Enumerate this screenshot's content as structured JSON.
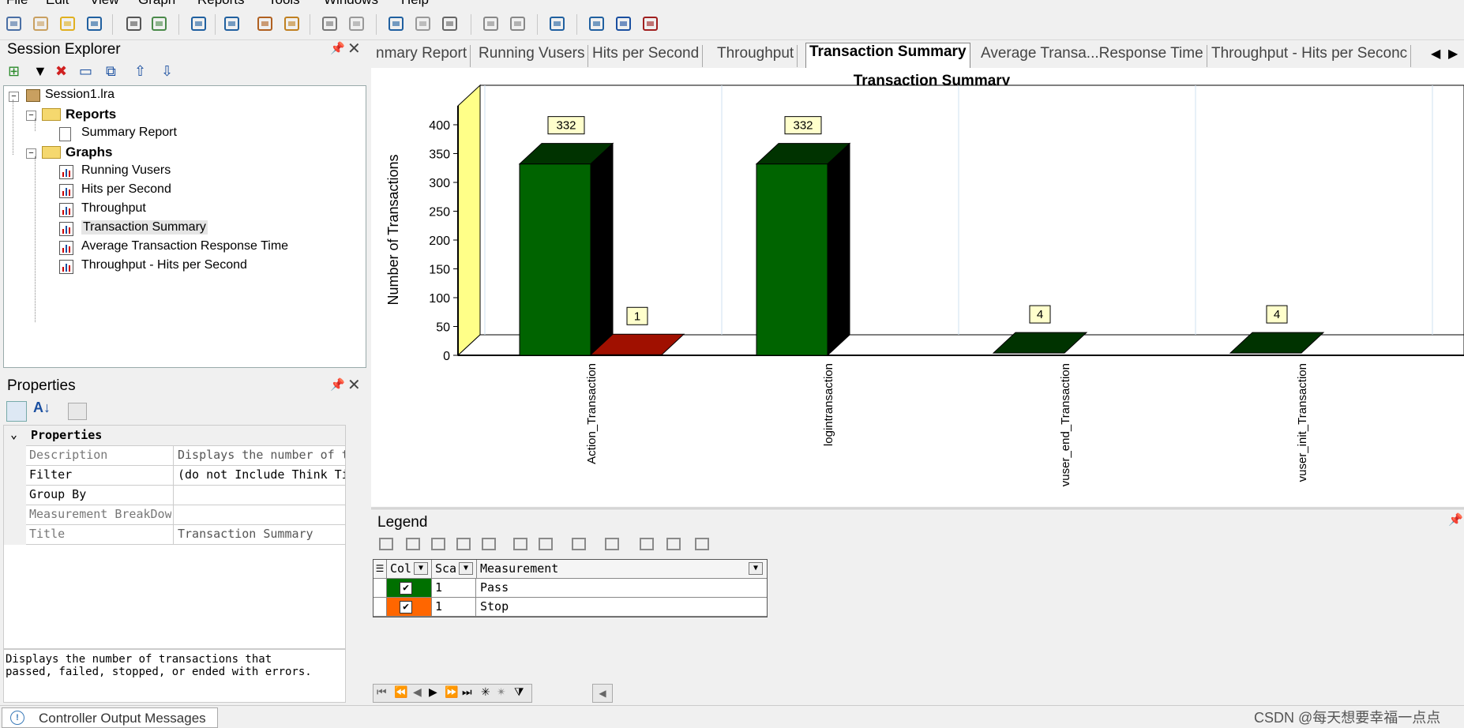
{
  "menu": {
    "items": [
      "File",
      "Edit",
      "View",
      "Graph",
      "Reports",
      "Tools",
      "Windows",
      "Help"
    ]
  },
  "toolbar": {
    "icons": [
      "new-session-icon",
      "open-icon",
      "add-graph-icon",
      "save-icon",
      "print-icon",
      "cross-result-icon",
      "html-report-icon",
      "filter-icon",
      "word-report-icon",
      "schedule-report-icon",
      "undo-icon",
      "redo-icon",
      "set-filter-icon",
      "clear-filter-icon",
      "group-by-icon",
      "merge-graphs-icon",
      "granularity-icon",
      "report-template-icon",
      "export-icon",
      "import-icon",
      "analyze-icon"
    ]
  },
  "session_explorer": {
    "title": "Session Explorer",
    "pin": "⬍",
    "close": "✕",
    "toolbar_icons": [
      "add-new-item-icon",
      "dropdown-icon",
      "delete-icon",
      "rename-icon",
      "duplicate-icon",
      "move-up-icon",
      "move-down-icon"
    ],
    "tree": {
      "root": "Session1.lra",
      "reports_label": "Reports",
      "reports": [
        "Summary Report"
      ],
      "graphs_label": "Graphs",
      "graphs": [
        "Running Vusers",
        "Hits per Second",
        "Throughput",
        "Transaction Summary",
        "Average Transaction Response Time",
        "Throughput - Hits per Second"
      ],
      "selected": "Transaction Summary"
    }
  },
  "properties": {
    "title": "Properties",
    "section": "Properties",
    "rows": [
      {
        "name": "Description",
        "value": "Displays the number of t",
        "readonly": true
      },
      {
        "name": "Filter",
        "value": "(do not Include Think Ti",
        "readonly": false
      },
      {
        "name": "Group By",
        "value": "",
        "readonly": false
      },
      {
        "name": "Measurement BreakDow",
        "value": "",
        "readonly": true
      },
      {
        "name": "Title",
        "value": "Transaction Summary",
        "readonly": true
      }
    ],
    "description_line1": "Displays the number of transactions that",
    "description_line2": "passed, failed, stopped, or ended with errors."
  },
  "tabs": {
    "items": [
      "nmary Report",
      "Running Vusers",
      "Hits per Second",
      "Throughput",
      "Transaction Summary",
      "Average Transa...Response Time",
      "Throughput - Hits per Seconc"
    ],
    "active_index": 4
  },
  "chart_data": {
    "type": "bar",
    "title": "Transaction Summary",
    "ylabel": "Number of Transactions",
    "xlabel": "",
    "ylim": [
      0,
      400
    ],
    "yticks": [
      0,
      50,
      100,
      150,
      200,
      250,
      300,
      350,
      400
    ],
    "categories": [
      "Action_Transaction",
      "logintransaction",
      "vuser_end_Transaction",
      "vuser_init_Transaction"
    ],
    "series": [
      {
        "name": "Pass",
        "color": "#006400",
        "values": [
          332,
          332,
          4,
          4
        ]
      },
      {
        "name": "Stop",
        "color": "#c01800",
        "values": [
          1,
          0,
          0,
          0
        ]
      }
    ],
    "data_labels": [
      "332",
      "1",
      "332",
      "4",
      "4"
    ],
    "grid": true
  },
  "legend": {
    "title": "Legend",
    "columns": [
      "Col",
      "Sca",
      "Measurement"
    ],
    "rows": [
      {
        "color": "#007000",
        "checked": "✔",
        "scale": "1",
        "measurement": "Pass"
      },
      {
        "color": "#ff6600",
        "checked": "✔",
        "scale": "1",
        "measurement": "Stop"
      }
    ]
  },
  "statusbar": {
    "tab": "Controller Output Messages",
    "watermark": "CSDN @每天想要幸福一点点"
  }
}
